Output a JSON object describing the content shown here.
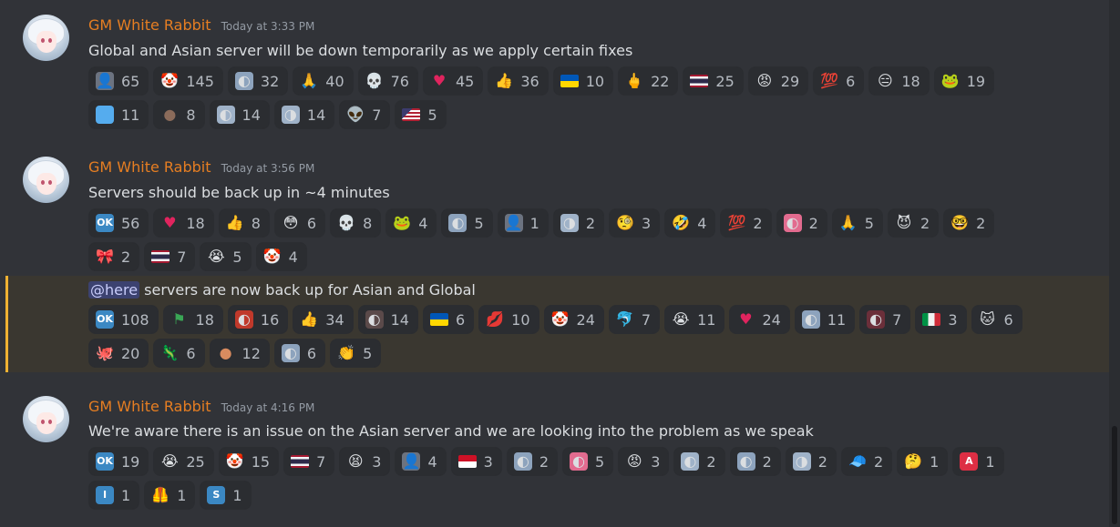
{
  "colors": {
    "bg": "#313338",
    "reaction_bg": "#2b2d31",
    "username": "#e67e22",
    "mention_bar": "#f0b232"
  },
  "messages": [
    {
      "author": "GM White Rabbit",
      "time": "Today at 3:33 PM",
      "text": "Global and Asian server will be down temporarily as we apply certain fixes",
      "reactions": [
        [
          {
            "icon": "ghost-girl-emoji",
            "glyph": "👤",
            "bg": "#6c7380",
            "count": "65"
          },
          {
            "icon": "clown-emoji",
            "glyph": "🤡",
            "count": "145"
          },
          {
            "icon": "anime-girl-emoji",
            "glyph": "◐",
            "bg": "#8da3bd",
            "count": "32"
          },
          {
            "icon": "folded-hands-emoji",
            "glyph": "🙏",
            "count": "40"
          },
          {
            "icon": "skull-emoji",
            "glyph": "💀",
            "count": "76"
          },
          {
            "icon": "red-heart-emoji",
            "glyph": "♥",
            "color": "#e0245e",
            "count": "45"
          },
          {
            "icon": "thumbs-up-emoji",
            "glyph": "👍",
            "count": "36"
          },
          {
            "icon": "ukraine-flag-emoji",
            "glyph": "",
            "flag": "ua",
            "count": "10"
          },
          {
            "icon": "middle-finger-emoji",
            "glyph": "🖕",
            "count": "22"
          },
          {
            "icon": "thailand-flag-emoji",
            "glyph": "",
            "flag": "th",
            "count": "25"
          },
          {
            "icon": "angry-face-emoji",
            "glyph": "😡",
            "count": "29"
          },
          {
            "icon": "hundred-points-emoji",
            "glyph": "💯",
            "count": "6"
          },
          {
            "icon": "expressionless-face-emoji",
            "glyph": "😑",
            "count": "18"
          },
          {
            "icon": "rainbow-frog-emoji",
            "glyph": "🐸",
            "count": "19"
          }
        ],
        [
          {
            "icon": "blue-square-emoji",
            "glyph": "",
            "bg": "#55acee",
            "count": "11"
          },
          {
            "icon": "brown-creature-emoji",
            "glyph": "●",
            "color": "#8b6b5a",
            "count": "8"
          },
          {
            "icon": "anime-girl-peek-emoji",
            "glyph": "◐",
            "bg": "#9fb2c8",
            "count": "14"
          },
          {
            "icon": "anime-girl-shocked-emoji",
            "glyph": "◑",
            "bg": "#9fb2c8",
            "count": "14"
          },
          {
            "icon": "alien-emoji",
            "glyph": "👽",
            "count": "7"
          },
          {
            "icon": "usa-flag-emoji",
            "glyph": "",
            "flag": "us",
            "count": "5"
          }
        ]
      ]
    },
    {
      "author": "GM White Rabbit",
      "time": "Today at 3:56 PM",
      "text": "Servers should be back up in ~4 minutes",
      "reactions": [
        [
          {
            "icon": "ok-button-emoji",
            "glyph": "OK",
            "bg": "#3b88c3",
            "txt": true,
            "count": "56"
          },
          {
            "icon": "red-heart-emoji",
            "glyph": "♥",
            "color": "#e0245e",
            "count": "18"
          },
          {
            "icon": "thumbs-up-emoji",
            "glyph": "👍",
            "count": "8"
          },
          {
            "icon": "flushed-face-emoji",
            "glyph": "😳",
            "count": "6"
          },
          {
            "icon": "skull-emoji",
            "glyph": "💀",
            "count": "8"
          },
          {
            "icon": "pepe-emoji",
            "glyph": "🐸",
            "count": "4"
          },
          {
            "icon": "anime-girl-emoji",
            "glyph": "◐",
            "bg": "#8da3bd",
            "count": "5"
          },
          {
            "icon": "ghost-girl-emoji",
            "glyph": "👤",
            "bg": "#6c7380",
            "count": "1"
          },
          {
            "icon": "anime-girl-sleepy-emoji",
            "glyph": "◑",
            "bg": "#9fb2c8",
            "count": "2"
          },
          {
            "icon": "face-with-monocle-emoji",
            "glyph": "🧐",
            "count": "3"
          },
          {
            "icon": "rolling-laughing-emoji",
            "glyph": "🤣",
            "count": "4"
          },
          {
            "icon": "hundred-points-emoji",
            "glyph": "💯",
            "count": "2"
          },
          {
            "icon": "pink-hair-girl-emoji",
            "glyph": "◐",
            "bg": "#e26b8f",
            "count": "2"
          },
          {
            "icon": "folded-hands-emoji",
            "glyph": "🙏",
            "count": "5"
          },
          {
            "icon": "devil-face-emoji",
            "glyph": "😈",
            "count": "2"
          },
          {
            "icon": "nerd-face-emoji",
            "glyph": "🤓",
            "count": "2"
          }
        ],
        [
          {
            "icon": "pink-bow-emoji",
            "glyph": "🎀",
            "count": "2"
          },
          {
            "icon": "thailand-flag-emoji",
            "glyph": "",
            "flag": "th",
            "count": "7"
          },
          {
            "icon": "crying-face-emoji",
            "glyph": "😭",
            "count": "5"
          },
          {
            "icon": "clown-emoji",
            "glyph": "🤡",
            "count": "4"
          }
        ]
      ]
    },
    {
      "mention": "@here",
      "text": " servers are now back up for Asian and Global",
      "reactions": [
        [
          {
            "icon": "ok-button-emoji",
            "glyph": "OK",
            "bg": "#3b88c3",
            "txt": true,
            "count": "108"
          },
          {
            "icon": "flag-mixed-emoji",
            "glyph": "⚑",
            "color": "#3aa655",
            "count": "18"
          },
          {
            "icon": "red-hair-girl-emoji",
            "glyph": "◐",
            "bg": "#c0392b",
            "count": "16"
          },
          {
            "icon": "thumbs-up-emoji",
            "glyph": "👍",
            "count": "34"
          },
          {
            "icon": "dark-hair-girl-emoji",
            "glyph": "◐",
            "bg": "#5b4a4a",
            "count": "14"
          },
          {
            "icon": "ukraine-flag-emoji",
            "glyph": "",
            "flag": "ua",
            "count": "6"
          },
          {
            "icon": "lips-emoji",
            "glyph": "💋",
            "count": "10"
          },
          {
            "icon": "clown-emoji",
            "glyph": "🤡",
            "count": "24"
          },
          {
            "icon": "dolphin-emoji",
            "glyph": "🐬",
            "count": "7"
          },
          {
            "icon": "crying-face-emoji",
            "glyph": "😭",
            "count": "11"
          },
          {
            "icon": "red-heart-emoji",
            "glyph": "♥",
            "color": "#e0245e",
            "count": "24"
          },
          {
            "icon": "anime-girl-emoji",
            "glyph": "◐",
            "bg": "#8da3bd",
            "count": "11"
          },
          {
            "icon": "dark-hair-girl-red-emoji",
            "glyph": "◐",
            "bg": "#6b2f3a",
            "count": "7"
          },
          {
            "icon": "italy-flag-emoji",
            "glyph": "",
            "flag": "it",
            "count": "3"
          },
          {
            "icon": "cat-emoji",
            "glyph": "🐱",
            "count": "6"
          }
        ],
        [
          {
            "icon": "octopus-emoji",
            "glyph": "🐙",
            "count": "20"
          },
          {
            "icon": "green-creature-emoji",
            "glyph": "🦎",
            "count": "6"
          },
          {
            "icon": "meme-face-emoji",
            "glyph": "●",
            "color": "#d98b5f",
            "count": "12"
          },
          {
            "icon": "anime-girl-emoji",
            "glyph": "◐",
            "bg": "#8da3bd",
            "count": "6"
          },
          {
            "icon": "clapping-hands-emoji",
            "glyph": "👏",
            "count": "5"
          }
        ]
      ]
    },
    {
      "author": "GM White Rabbit",
      "time": "Today at 4:16 PM",
      "text": "We're aware there is an issue on the Asian server and we are looking into the problem as we speak",
      "reactions": [
        [
          {
            "icon": "ok-button-emoji",
            "glyph": "OK",
            "bg": "#3b88c3",
            "txt": true,
            "count": "19"
          },
          {
            "icon": "crying-face-emoji",
            "glyph": "😭",
            "count": "25"
          },
          {
            "icon": "clown-emoji",
            "glyph": "🤡",
            "count": "15"
          },
          {
            "icon": "thailand-flag-emoji",
            "glyph": "",
            "flag": "th",
            "count": "7"
          },
          {
            "icon": "tired-face-emoji",
            "glyph": "😫",
            "count": "3"
          },
          {
            "icon": "ghost-girl-emoji",
            "glyph": "👤",
            "bg": "#6c7380",
            "count": "4"
          },
          {
            "icon": "indonesia-flag-emoji",
            "glyph": "",
            "flag": "id",
            "count": "3"
          },
          {
            "icon": "anime-girl-emoji",
            "glyph": "◐",
            "bg": "#8da3bd",
            "count": "2"
          },
          {
            "icon": "pink-hair-girl-emoji",
            "glyph": "◐",
            "bg": "#e26b8f",
            "count": "5"
          },
          {
            "icon": "angry-pepe-emoji",
            "glyph": "😡",
            "count": "3"
          },
          {
            "icon": "anime-girl-peek-emoji",
            "glyph": "◐",
            "bg": "#9fb2c8",
            "count": "2"
          },
          {
            "icon": "anime-girl-emoji",
            "glyph": "◐",
            "bg": "#8da3bd",
            "count": "2"
          },
          {
            "icon": "anime-girl-shocked-emoji",
            "glyph": "◑",
            "bg": "#9fb2c8",
            "count": "2"
          },
          {
            "icon": "blue-cap-emoji",
            "glyph": "🧢",
            "count": "2"
          },
          {
            "icon": "thinking-face-emoji",
            "glyph": "🤔",
            "count": "1"
          },
          {
            "icon": "letter-a-emoji",
            "glyph": "A",
            "bg": "#dd2e44",
            "txt": true,
            "count": "1"
          }
        ],
        [
          {
            "icon": "letter-i-emoji",
            "glyph": "I",
            "bg": "#3b88c3",
            "txt": true,
            "count": "1"
          },
          {
            "icon": "safety-vest-emoji",
            "glyph": "🦺",
            "count": "1"
          },
          {
            "icon": "letter-s-emoji",
            "glyph": "S",
            "bg": "#3b88c3",
            "txt": true,
            "count": "1"
          }
        ]
      ]
    }
  ]
}
